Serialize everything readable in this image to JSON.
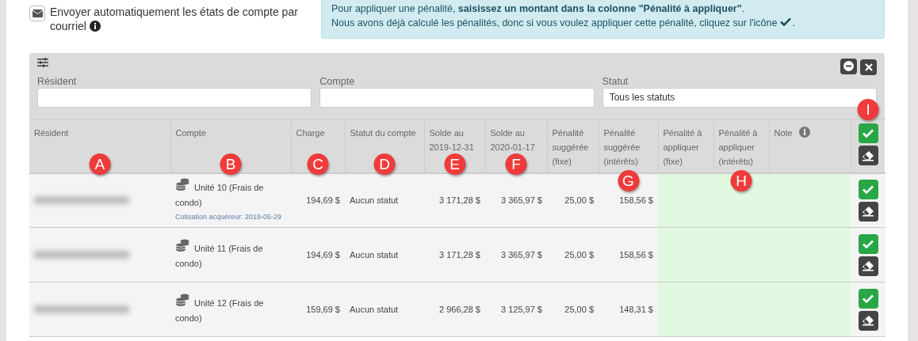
{
  "email_option": {
    "label": "Envoyer automatiquement les états de compte par courriel"
  },
  "info_alert": {
    "lines": [
      "Pour appliquer une pénalité, **saisissez un montant dans la colonne \"Pénalité à appliquer\"**.",
      "Nous avons déjà calculé les pénalités, donc si vous voulez appliquer cette pénalité, cliquez sur l'icône"
    ],
    "trailing": "."
  },
  "filters": [
    {
      "label": "Résident"
    },
    {
      "label": "Compte"
    },
    {
      "label": "Statut",
      "value": "Tous les statuts"
    }
  ],
  "columns": [
    {
      "label": "Résident",
      "marker": "A",
      "kind": "name"
    },
    {
      "label": "Compte",
      "marker": "B",
      "kind": "account"
    },
    {
      "label": "Charge",
      "marker": "C",
      "kind": "amount"
    },
    {
      "label": "Statut du compte",
      "marker": "D",
      "kind": "status"
    },
    {
      "label": "Solde au 2019-12-31",
      "marker": "E",
      "kind": "amount"
    },
    {
      "label": "Solde au 2020-01-17",
      "marker": "F",
      "kind": "amount"
    },
    {
      "label": "Pénalité suggérée (fixe)",
      "kind": "amount"
    },
    {
      "label": "Pénalité suggérée (intérêts)",
      "marker": "G",
      "marker_below": true,
      "kind": "amount"
    },
    {
      "label": "Pénalité à appliquer (fixe)",
      "kind": "input"
    },
    {
      "label": "Pénalité à appliquer (intérêts)",
      "marker": "H",
      "marker_below": true,
      "kind": "input"
    },
    {
      "label": "Note",
      "info": true,
      "kind": "input"
    },
    {
      "marker": "I",
      "kind": "actions"
    }
  ],
  "rows": [
    {
      "account": "Unité 10 (Frais de condo)",
      "note": "Cotisation acquéreur: 2019-05-29",
      "charge": "194,69 $",
      "status": "Aucun statut",
      "balance_1": "3 171,28 $",
      "balance_2": "3 365,97 $",
      "penalty_fixed": "25,00 $",
      "penalty_interest": "158,56 $"
    },
    {
      "account": "Unité 11 (Frais de condo)",
      "charge": "194,69 $",
      "status": "Aucun statut",
      "balance_1": "3 171,28 $",
      "balance_2": "3 365,97 $",
      "penalty_fixed": "25,00 $",
      "penalty_interest": "158,56 $"
    },
    {
      "account": "Unité 12 (Frais de condo)",
      "charge": "159,69 $",
      "status": "Aucun statut",
      "balance_1": "2 966,28 $",
      "balance_2": "3 125,97 $",
      "penalty_fixed": "25,00 $",
      "penalty_interest": "148,31 $"
    }
  ]
}
